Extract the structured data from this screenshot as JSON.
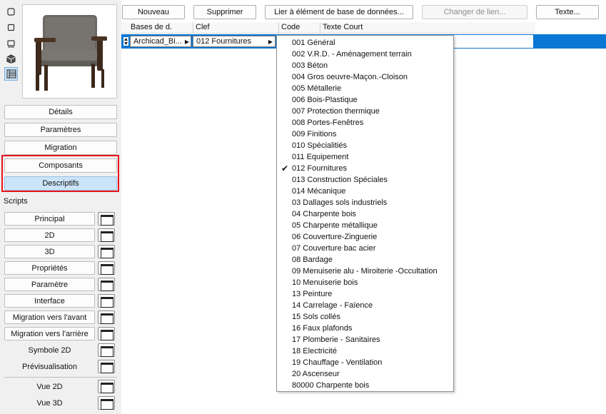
{
  "toolbar_left": {
    "icons": [
      "select-outline-icon",
      "select-square-icon",
      "model-3d-icon",
      "cube-icon",
      "list-view-icon"
    ]
  },
  "panel": {
    "buttons": [
      "Détails",
      "Paramètres",
      "Migration",
      "Composants",
      "Descriptifs"
    ],
    "selected": "Descriptifs",
    "scripts_label": "Scripts",
    "scripts": [
      "Principal",
      "2D",
      "3D",
      "Propriétés",
      "Paramètre",
      "Interface",
      "Migration vers l'avant",
      "Migration vers l'arrière",
      "Symbole 2D",
      "Prévisualisation"
    ],
    "views": [
      "Vue 2D",
      "Vue 3D"
    ]
  },
  "top_buttons": {
    "new": "Nouveau",
    "delete": "Supprimer",
    "link_db": "Lier à élément de base de données...",
    "change_link": "Changer de lien...",
    "text": "Texte..."
  },
  "table": {
    "headers": [
      "Bases de d.",
      "Clef",
      "Code",
      "Texte Court"
    ],
    "row": {
      "database": "Archicad_Bi...",
      "key": "012  Fournitures"
    }
  },
  "dropdown": {
    "checked": "012  Fournitures",
    "items": [
      "001  Général",
      "002  V.R.D. - Aménagement terrain",
      "003  Béton",
      "004  Gros oeuvre-Maçon.-Cloison",
      "005  Métallerie",
      "006  Bois-Plastique",
      "007  Protection thermique",
      "008  Portes-Fenêtres",
      "009  Finitions",
      "010  Spécialitiés",
      "011  Equipement",
      "012  Fournitures",
      "013  Construction Spéciales",
      "014  Mécanique",
      "03  Dallages sols industriels",
      "04  Charpente bois",
      "05  Charpente métallique",
      "06  Couverture-Zinguerie",
      "07  Couverture bac acier",
      "08  Bardage",
      "09  Menuiserie alu - Miroiterie -Occultation",
      "10  Menuiserie bois",
      "13  Peinture",
      "14  Carrelage - Faïence",
      "15  Sols collés",
      "16  Faux plafonds",
      "17  Plomberie - Sanitaires",
      "18  Electricité",
      "19  Chauffage - Ventilation",
      "20  Ascenseur",
      "80000  Charpente bois"
    ]
  },
  "colors": {
    "selection": "#0a77d3",
    "highlight_box": "#e8131b",
    "selected_button": "#cce4f7"
  }
}
